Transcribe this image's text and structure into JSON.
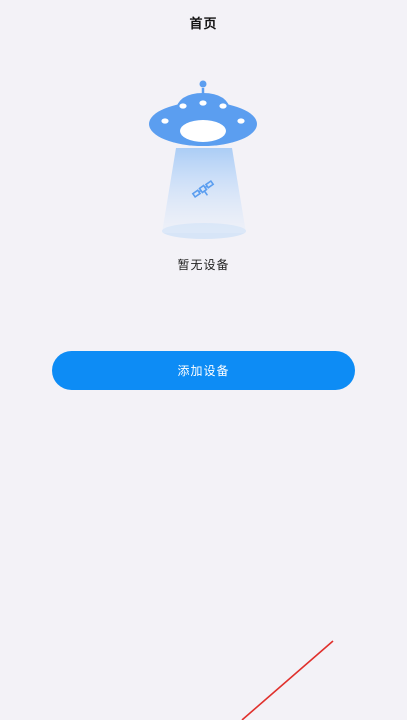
{
  "header": {
    "title": "首页"
  },
  "empty_state": {
    "message": "暂无设备",
    "illustration": "ufo-no-device-icon"
  },
  "actions": {
    "add_device_label": "添加设备"
  },
  "colors": {
    "background": "#f3f2f7",
    "primary": "#0d8cf5",
    "ufo": "#5b9ef0",
    "beam": "#bcd8f8",
    "decoration_line": "#e0302c"
  }
}
